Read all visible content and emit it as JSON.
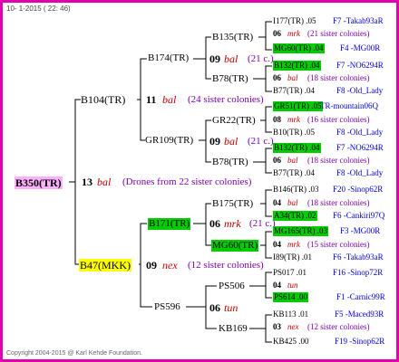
{
  "header": "10- 1-2015 ( 22: 46)",
  "footer": "Copyright 2004-2015 @ Karl Kehde Foundation.",
  "root": {
    "name": "B350(TR)",
    "num": "13",
    "race": "bal",
    "note": "(Drones from 22 sister colonies)"
  },
  "g1": [
    {
      "name": "B104(TR)",
      "num": "11",
      "race": "bal",
      "note": "(24 sister colonies)"
    },
    {
      "name": "B47(MKK)",
      "num": "09",
      "race": "nex",
      "note": "(12 sister colonies)"
    }
  ],
  "g2": [
    {
      "name": "B174(TR)",
      "num": "09",
      "race": "bal",
      "note": "(21 c.)"
    },
    {
      "name": "GR109(TR)",
      "num": "09",
      "race": "bal",
      "note": "(21 c.)"
    },
    {
      "name": "B171(TR)",
      "num": "06",
      "race": "mrk",
      "note": "(21 c.)"
    },
    {
      "name": "PS596",
      "num": "06",
      "race": "tun",
      "note": ""
    }
  ],
  "g3": [
    "B135(TR)",
    "B78(TR)",
    "GR22(TR)",
    "B78(TR)",
    "B175(TR)",
    "MG60(TR)",
    "PS506",
    "KB169"
  ],
  "g4": [
    {
      "top": "I177(TR) .05",
      "top_r": "F7 -Takab93aR",
      "num": "06",
      "race": "mrk",
      "note": "(21 sister colonies)",
      "bot": "MG60(TR) .04",
      "bot_r": "F4 -MG00R"
    },
    {
      "top": "B132(TR) .04",
      "top_r": "F7 -NO6294R",
      "num": "06",
      "race": "bal",
      "note": "(18 sister colonies)",
      "bot": "B77(TR) .04",
      "bot_r": "F8 -Old_Lady"
    },
    {
      "top": "GR51(TR) .05",
      "top_r": "TR-mountain06Q",
      "num": "08",
      "race": "mrk",
      "note": "(16 sister colonies)",
      "bot": "B10(TR) .05",
      "bot_r": "F8 -Old_Lady"
    },
    {
      "top": "B132(TR) .04",
      "top_r": "F7 -NO6294R",
      "num": "06",
      "race": "bal",
      "note": "(18 sister colonies)",
      "bot": "B77(TR) .04",
      "bot_r": "F8 -Old_Lady"
    },
    {
      "top": "B146(TR) .03",
      "top_r": "F20 -Sinop62R",
      "num": "04",
      "race": "bal",
      "note": "(18 sister colonies)",
      "bot": "A34(TR) .02",
      "bot_r": "F6 -Cankiri97Q"
    },
    {
      "top": "MG165(TR) .03",
      "top_r": "F3 -MG00R",
      "num": "04",
      "race": "mrk",
      "note": "(15 sister colonies)",
      "bot": "I89(TR) .01",
      "bot_r": "F6 -Takab93aR"
    },
    {
      "top": "PS017 .01",
      "top_r": "F16 -Sinop72R",
      "num": "04",
      "race": "tun",
      "note": "",
      "bot": "PS614 .00",
      "bot_r": "F1 -Carnic99R"
    },
    {
      "top": "KB113 .01",
      "top_r": "F5 -Maced93R",
      "num": "03",
      "race": "nex",
      "note": "(12 sister colonies)",
      "bot": "KB425 .00",
      "bot_r": "F19 -Sinop62R"
    }
  ]
}
